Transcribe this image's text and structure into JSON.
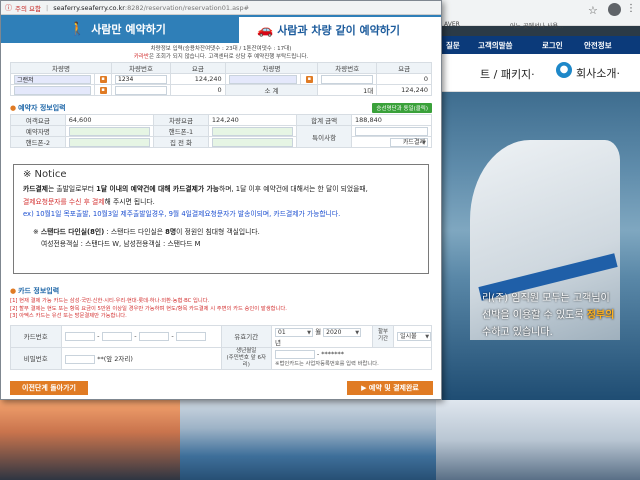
{
  "browser": {
    "bookmarks": [
      "AVER",
      "어느 곳에서나 사용..."
    ]
  },
  "site": {
    "nav": [
      "질문",
      "고객의말씀",
      "로그인",
      "안전정보"
    ],
    "package_menu": "트 / 패키지·",
    "company_menu": "회사소개·",
    "hero_lines": [
      "리(주) 임직원 모두는 고객님이",
      "선박을 이용할 수 있도록 정부의",
      "수하고 있습니다."
    ],
    "hero_highlight": "정부의"
  },
  "popup": {
    "address": {
      "warning": "주의 요함",
      "host": "seaferry.seaferry.co.kr",
      "path": ":8282/reservation/reservation01.asp#"
    },
    "tabs": {
      "passenger": "사람만 예약하기",
      "with_vehicle": "사람과 차량 같이 예약하기"
    },
    "vehicle_info": {
      "line1": "차량정보 입력(승용차잔여댓수 : 23대 / 1톤잔여댓수 : 17대)",
      "line2_red": "카라반",
      "line2_rest": "은 조회가 되지 않습니다. 고객센터로 상담 후 예약진행 부탁드립니다."
    },
    "vehicle_table": {
      "headers": [
        "차량명",
        "차량번호",
        "요금",
        "차량명",
        "차량번호",
        "요금"
      ],
      "row1": [
        "그랜저",
        "1234",
        "124,240",
        "",
        "",
        "0"
      ],
      "row2": [
        "",
        "",
        "0",
        "소 계",
        "1대",
        "124,240"
      ]
    },
    "reservation_info": {
      "title": "예약자 정보입력",
      "same_button": "승선명단과 동일(클릭)",
      "labels": {
        "passenger_fee": "여객요금",
        "vehicle_fee": "차량요금",
        "total_fee": "합계 금액",
        "reserver_name": "예약자명",
        "phone1": "핸드폰-1",
        "remarks": "특이사항",
        "phone2": "핸드폰-2",
        "home_phone": "집 전 화"
      },
      "values": {
        "passenger_fee": "64,600",
        "vehicle_fee": "124,240",
        "total_fee": "188,840",
        "payment_method": "카드결제"
      }
    },
    "notice": {
      "title": "※ Notice",
      "p1_a": "카드결제",
      "p1_b": "는 출발일로부터 ",
      "p1_c": "1달 이내의 예약건에 대해 카드결제가 가능",
      "p1_d": "하며, 1달 이후 예약건에 대해서는 한 달이 되었을때,",
      "p2_red": "결제요청문자를 수신 후 결제",
      "p2_rest": "해 주시면 됩니다.",
      "p3_blue": "ex) 10월1일 목포출발, 10월3일 제주출발일경우, 9월 4일결제요청문자가 발송이되며, 카드결제가 가능합니다.",
      "p4_a": "※ ",
      "p4_b": "스탠다드 다인실(8인)",
      "p4_c": " : 스탠다드 다인실은 ",
      "p4_d": "8명",
      "p4_e": "이 정원인 침대형 객실입니다.",
      "p5": "여성전용객실 : 스탠다드 W, 남성전용객실 : 스탠다드 M"
    },
    "card_info": {
      "title": "카드 정보입력",
      "notes": [
        "[1] 현재 결제 가능 카드는 삼성·국민·신한·시티·우리·현대·롯데·하나·외환·농협·BC 입니다.",
        "[2] 할부 결제는 현도 또는 항목 요금이 5만원 이상일 경우만 가능하며 현도/항목 카드결제 시 주변의 카드 승인이 발생합니다.",
        "[3] 아멕스 카드는 유선 또는 방문결제만 가능합니다."
      ],
      "labels": {
        "card_number": "카드번호",
        "expiry": "유효기간",
        "installment": "할부\n기간",
        "password": "비밀번호",
        "birth": "생년월일\n(주민번호 앞 6자리)"
      },
      "expiry_month": "01",
      "expiry_month_unit": "월",
      "expiry_year": "2020",
      "expiry_year_unit": "년",
      "installment_value": "일시불",
      "password_hint": "**(앞 2자리)",
      "birth_mask": "- *******",
      "birth_note": "※법인카드는 사업자등록번호를 입력 바랍니다."
    },
    "buttons": {
      "prev": "이전단계 돌아가기",
      "pay": "예약 및 결제완료"
    }
  }
}
